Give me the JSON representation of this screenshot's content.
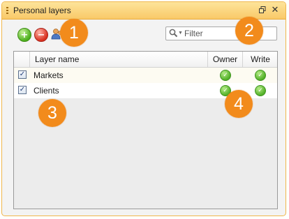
{
  "window": {
    "title": "Personal layers"
  },
  "toolbar": {
    "add_icon": "add-icon",
    "remove_icon": "remove-icon",
    "user_icon": "user-permissions-icon"
  },
  "filter": {
    "placeholder": "Filter",
    "value": ""
  },
  "grid": {
    "columns": [
      "",
      "Layer name",
      "Owner",
      "Write"
    ],
    "rows": [
      {
        "checked": true,
        "name": "Markets",
        "owner": true,
        "write": true
      },
      {
        "checked": true,
        "name": "Clients",
        "owner": true,
        "write": true
      }
    ]
  },
  "callouts": [
    "1",
    "2",
    "3",
    "4"
  ],
  "colors": {
    "title_bar": "#f9c968",
    "callout": "#f28b1c",
    "ok": "#52b028"
  }
}
